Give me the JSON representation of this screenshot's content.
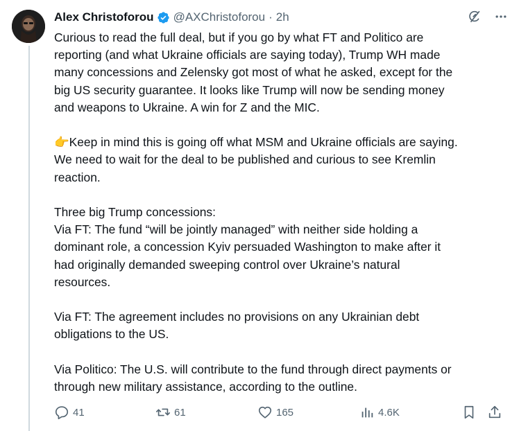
{
  "author": {
    "name": "Alex Christoforou",
    "handle": "@AXChristoforou",
    "separator": "·",
    "time": "2h"
  },
  "paragraphs": [
    {
      "lines": [
        "Curious to read the full deal, but if you go by what FT and Politico are",
        "reporting (and what Ukraine officials are saying today), Trump WH made",
        "many concessions and Zelensky got most of what he asked, except for the",
        "big US security guarantee. It looks like Trump will now be sending money",
        "and weapons to Ukraine. A win for Z and the MIC."
      ]
    },
    {
      "lines": [
        "👉Keep in mind this is going off what MSM and Ukraine officials are saying.",
        "We need to wait for the deal to be published and curious to see Kremlin",
        "reaction."
      ]
    },
    {
      "lines": [
        "Three big Trump concessions:",
        "Via FT: The fund “will be jointly managed” with neither side holding a",
        "dominant role, a concession Kyiv persuaded Washington to make after it",
        "had originally demanded sweeping control over Ukraine’s natural",
        "resources."
      ]
    },
    {
      "lines": [
        "Via FT: The agreement includes no provisions on any Ukrainian debt",
        "obligations to the US."
      ]
    },
    {
      "lines": [
        "Via Politico: The U.S. will contribute to the fund through direct payments or",
        "through new military assistance, according to the outline."
      ]
    }
  ],
  "actions": {
    "replies": "41",
    "reposts": "61",
    "likes": "165",
    "views": "4.6K"
  },
  "icons": {
    "verified": "verified-badge-icon",
    "grok": "grok-icon",
    "more": "more-icon",
    "reply": "reply-icon",
    "repost": "repost-icon",
    "like": "like-icon",
    "views": "views-icon",
    "bookmark": "bookmark-icon",
    "share": "share-icon"
  },
  "colors": {
    "text": "#0f1419",
    "secondary": "#536471",
    "verified": "#1d9bf0",
    "thread_line": "#cfd9de"
  }
}
